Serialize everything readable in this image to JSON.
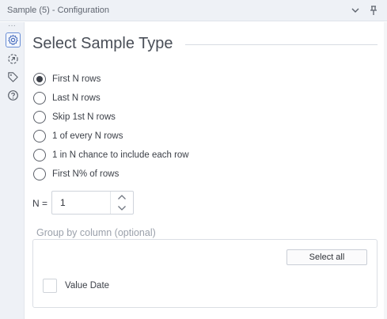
{
  "window": {
    "title": "Sample (5) - Configuration",
    "chevron_icon": "chevron-down-icon",
    "pin_icon": "pin-icon"
  },
  "sidebar": {
    "more_dots": "···",
    "items": [
      {
        "icon": "gear-icon",
        "active": true
      },
      {
        "icon": "arrow-circle-icon",
        "active": false
      },
      {
        "icon": "tag-icon",
        "active": false
      },
      {
        "icon": "help-circle-icon",
        "active": false
      }
    ]
  },
  "main": {
    "heading": "Select Sample Type",
    "options": [
      {
        "label": "First N rows",
        "checked": true
      },
      {
        "label": "Last N rows",
        "checked": false
      },
      {
        "label": "Skip 1st N rows",
        "checked": false
      },
      {
        "label": "1 of every N rows",
        "checked": false
      },
      {
        "label": "1 in N chance to include each row",
        "checked": false
      },
      {
        "label": "First N% of rows",
        "checked": false
      }
    ],
    "n_label": "N =",
    "n_value": "1",
    "group": {
      "label": "Group by column (optional)",
      "select_all_label": "Select all",
      "columns": [
        {
          "label": "Value Date",
          "checked": false
        }
      ]
    }
  },
  "colors": {
    "accent": "#6b8fd6",
    "titlebar_bg": "#eef1f6",
    "text": "#3b3f47",
    "muted_text": "#9ba1ab"
  }
}
